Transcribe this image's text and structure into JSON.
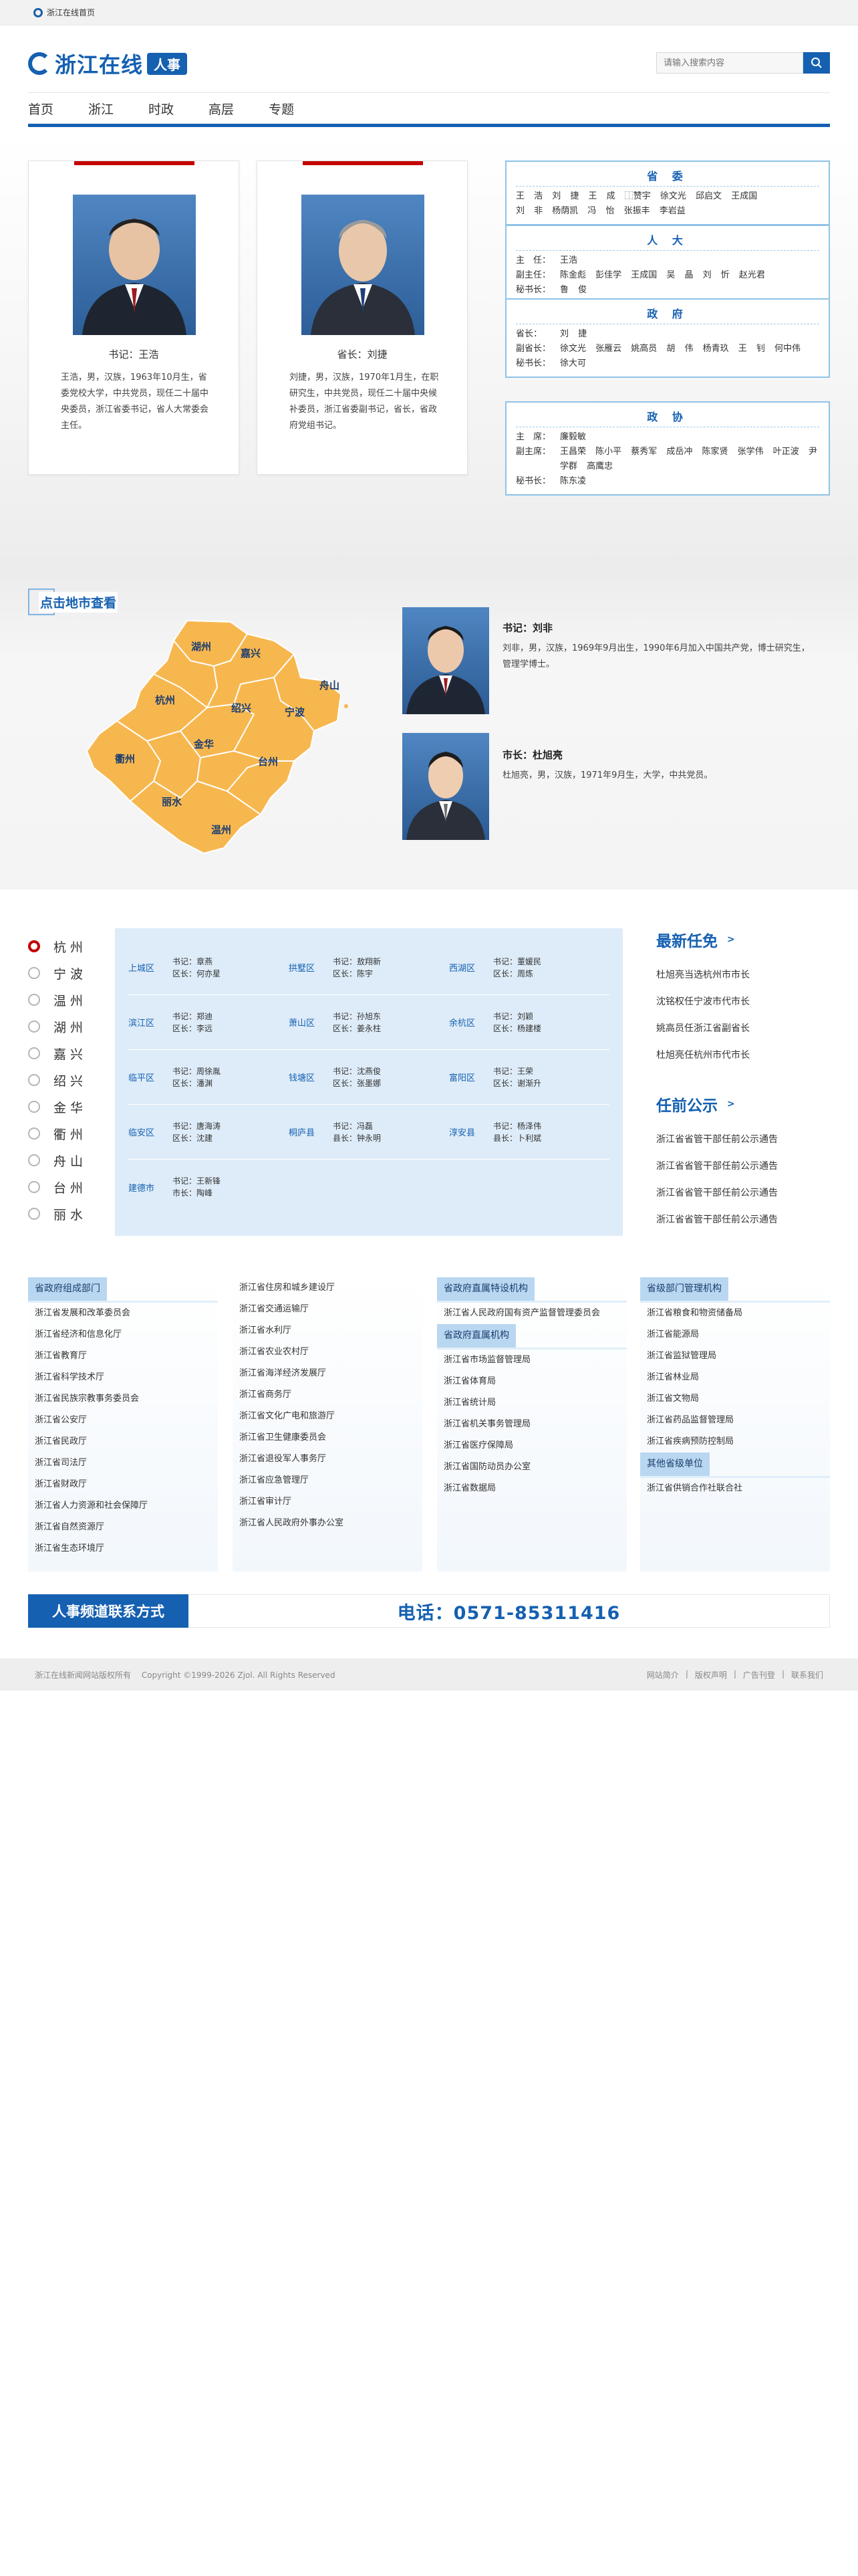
{
  "topbar": {
    "home": "浙江在线首页"
  },
  "brand": {
    "name": "浙江在线",
    "tag": "人事"
  },
  "search": {
    "placeholder": "请输入搜索内容"
  },
  "nav": [
    "首页",
    "浙江",
    "时政",
    "高层",
    "专题"
  ],
  "leaders": [
    {
      "caption": "书记：王浩",
      "bio": "王浩，男，汉族，1963年10月生，省委党校大学，中共党员，现任二十届中央委员，浙江省委书记，省人大常委会主任。"
    },
    {
      "caption": "省长：刘捷",
      "bio": "刘捷，男，汉族，1970年1月生，在职研究生，中共党员，现任二十届中央候补委员，浙江省委副书记，省长，省政府党组书记。"
    }
  ],
  "orgs": [
    {
      "title": "省 委",
      "rows": [
        {
          "k": "",
          "v": "王 浩  刘 捷  王 成  ⿰赞宇  徐文光  邱启文  王成国"
        },
        {
          "k": "",
          "v": "刘 非  杨荫凯  冯 怡  张振丰  李岩益"
        }
      ]
    },
    {
      "title": "人 大",
      "rows": [
        {
          "k": "主　任：",
          "v": "王浩"
        },
        {
          "k": "副主任：",
          "v": "陈金彪  彭佳学  王成国  吴 晶  刘 忻  赵光君"
        },
        {
          "k": "秘书长：",
          "v": "鲁 俊"
        }
      ]
    },
    {
      "title": "政 府",
      "rows": [
        {
          "k": "省长：",
          "v": "刘 捷"
        },
        {
          "k": "副省长：",
          "v": "徐文光  张雁云  姚高员  胡 伟  杨青玖  王 钊  何中伟"
        },
        {
          "k": "秘书长：",
          "v": "徐大可"
        }
      ]
    },
    {
      "title": "政 协",
      "rows": [
        {
          "k": "主　席：",
          "v": "廉毅敏"
        },
        {
          "k": "副主席：",
          "v": "王昌荣  陈小平  蔡秀军  成岳冲  陈家贤  张学伟  叶正波  尹学群  高鹰忠"
        },
        {
          "k": "秘书长：",
          "v": "陈东凌"
        }
      ]
    }
  ],
  "citysection": {
    "title": "点击地市查看",
    "map_labels": [
      "湖州",
      "嘉兴",
      "杭州",
      "舟山",
      "绍兴",
      "宁波",
      "衢州",
      "金华",
      "台州",
      "丽水",
      "温州"
    ],
    "secretary": {
      "title": "书记：刘非",
      "bio": "刘非，男，汉族，1969年9月出生，1990年6月加入中国共产党，博士研究生，管理学博士。"
    },
    "mayor": {
      "title": "市长：杜旭亮",
      "bio": "杜旭亮，男，汉族，1971年9月生，大学，中共党员。"
    }
  },
  "cities": [
    "杭州",
    "宁波",
    "温州",
    "湖州",
    "嘉兴",
    "绍兴",
    "金华",
    "衢州",
    "舟山",
    "台州",
    "丽水"
  ],
  "districts": [
    [
      {
        "n": "上城区",
        "a": "书记：章燕",
        "b": "区长：何亦星"
      },
      {
        "n": "拱墅区",
        "a": "书记：敖翔新",
        "b": "区长：陈宇"
      },
      {
        "n": "西湖区",
        "a": "书记：董媛民",
        "b": "区长：周炼"
      }
    ],
    [
      {
        "n": "滨江区",
        "a": "书记：郑迪",
        "b": "区长：李远"
      },
      {
        "n": "萧山区",
        "a": "书记：孙旭东",
        "b": "区长：姜永柱"
      },
      {
        "n": "余杭区",
        "a": "书记：刘颖",
        "b": "区长：杨建楼"
      }
    ],
    [
      {
        "n": "临平区",
        "a": "书记：周徐胤",
        "b": "区长：潘渊"
      },
      {
        "n": "钱塘区",
        "a": "书记：沈燕俊",
        "b": "区长：张墨娜"
      },
      {
        "n": "富阳区",
        "a": "书记：王荣",
        "b": "区长：谢渐升"
      }
    ],
    [
      {
        "n": "临安区",
        "a": "书记：唐海涛",
        "b": "区长：沈建"
      },
      {
        "n": "桐庐县",
        "a": "书记：冯磊",
        "b": "县长：钟永明"
      },
      {
        "n": "淳安县",
        "a": "书记：杨泽伟",
        "b": "县长：卜利斌"
      }
    ],
    [
      {
        "n": "建德市",
        "a": "书记：王新锋",
        "b": "市长：陶峰"
      }
    ]
  ],
  "news": {
    "appoint_title": "最新任免",
    "appoint": [
      "杜旭亮当选杭州市市长",
      "沈铭权任宁波市代市长",
      "姚高员任浙江省副省长",
      "杜旭亮任杭州市代市长"
    ],
    "notice_title": "任前公示",
    "notice": [
      "浙江省省管干部任前公示通告",
      "浙江省省管干部任前公示通告",
      "浙江省省管干部任前公示通告",
      "浙江省省管干部任前公示通告"
    ]
  },
  "depts": [
    {
      "groups": [
        {
          "h": "省政府组成部门",
          "items": [
            "浙江省发展和改革委员会",
            "浙江省经济和信息化厅",
            "浙江省教育厅",
            "浙江省科学技术厅",
            "浙江省民族宗教事务委员会",
            "浙江省公安厅",
            "浙江省民政厅",
            "浙江省司法厅",
            "浙江省财政厅",
            "浙江省人力资源和社会保障厅",
            "浙江省自然资源厅",
            "浙江省生态环境厅"
          ]
        }
      ]
    },
    {
      "groups": [
        {
          "h": "",
          "items": [
            "浙江省住房和城乡建设厅",
            "浙江省交通运输厅",
            "浙江省水利厅",
            "浙江省农业农村厅",
            "浙江省海洋经济发展厅",
            "浙江省商务厅",
            "浙江省文化广电和旅游厅",
            "浙江省卫生健康委员会",
            "浙江省退役军人事务厅",
            "浙江省应急管理厅",
            "浙江省审计厅",
            "浙江省人民政府外事办公室"
          ]
        }
      ]
    },
    {
      "groups": [
        {
          "h": "省政府直属特设机构",
          "items": [
            "浙江省人民政府国有资产监督管理委员会"
          ]
        },
        {
          "h": "省政府直属机构",
          "items": [
            "浙江省市场监督管理局",
            "浙江省体育局",
            "浙江省统计局",
            "浙江省机关事务管理局",
            "浙江省医疗保障局",
            "浙江省国防动员办公室",
            "浙江省数据局"
          ]
        }
      ]
    },
    {
      "groups": [
        {
          "h": "省级部门管理机构",
          "items": [
            "浙江省粮食和物资储备局",
            "浙江省能源局",
            "浙江省监狱管理局",
            "浙江省林业局",
            "浙江省文物局",
            "浙江省药品监督管理局",
            "浙江省疾病预防控制局"
          ]
        },
        {
          "h": "其他省级单位",
          "items": [
            "浙江省供销合作社联合社"
          ]
        }
      ]
    }
  ],
  "contact": {
    "label": "人事频道联系方式",
    "phone": "电话：0571-85311416"
  },
  "footer": {
    "left": "浙江在线新闻网站版权所有　 Copyright ©1999-2026 Zjol. All Rights Reserved",
    "links": [
      "网站简介",
      "版权声明",
      "广告刊登",
      "联系我们"
    ]
  },
  "colors": {
    "brand": "#1560b1",
    "accent_red": "#c40000",
    "map_fill": "#f7b74f",
    "panel": "#deecf9"
  }
}
